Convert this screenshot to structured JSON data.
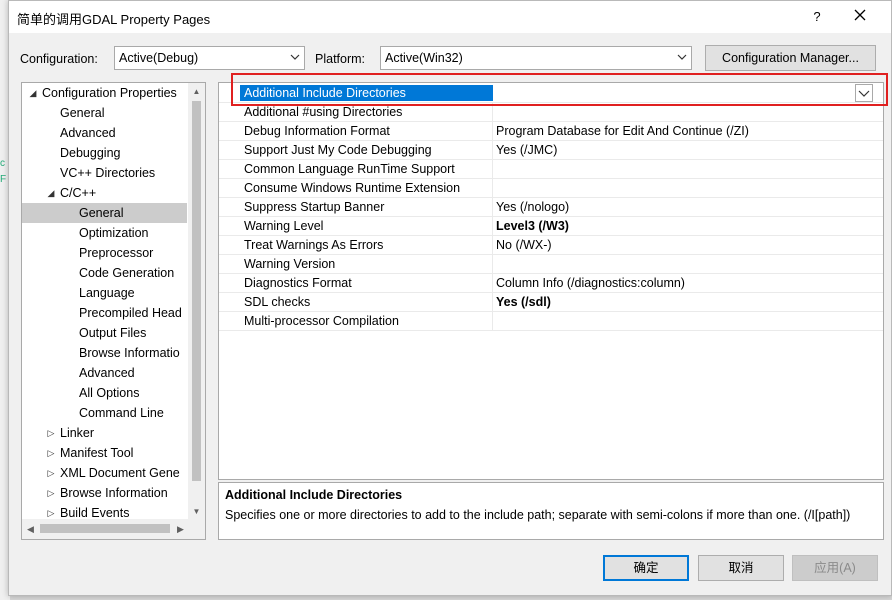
{
  "window": {
    "title": "简单的调用GDAL Property Pages",
    "help_glyph": "?",
    "close_glyph": "✕"
  },
  "background": {
    "left_text_1": "c",
    "left_text_2": "F"
  },
  "toolbar": {
    "configuration_label": "Configuration:",
    "configuration_value": "Active(Debug)",
    "platform_label": "Platform:",
    "platform_value": "Active(Win32)",
    "config_manager_label": "Configuration Manager..."
  },
  "tree": {
    "items": [
      {
        "label": "Configuration Properties",
        "glyph": "◢"
      },
      {
        "label": "General",
        "glyph": ""
      },
      {
        "label": "Advanced",
        "glyph": ""
      },
      {
        "label": "Debugging",
        "glyph": ""
      },
      {
        "label": "VC++ Directories",
        "glyph": ""
      },
      {
        "label": "C/C++",
        "glyph": "◢"
      },
      {
        "label": "General",
        "glyph": ""
      },
      {
        "label": "Optimization",
        "glyph": ""
      },
      {
        "label": "Preprocessor",
        "glyph": ""
      },
      {
        "label": "Code Generation",
        "glyph": ""
      },
      {
        "label": "Language",
        "glyph": ""
      },
      {
        "label": "Precompiled Head",
        "glyph": ""
      },
      {
        "label": "Output Files",
        "glyph": ""
      },
      {
        "label": "Browse Informatio",
        "glyph": ""
      },
      {
        "label": "Advanced",
        "glyph": ""
      },
      {
        "label": "All Options",
        "glyph": ""
      },
      {
        "label": "Command Line",
        "glyph": ""
      },
      {
        "label": "Linker",
        "glyph": "▷"
      },
      {
        "label": "Manifest Tool",
        "glyph": "▷"
      },
      {
        "label": "XML Document Gene",
        "glyph": "▷"
      },
      {
        "label": "Browse Information",
        "glyph": "▷"
      },
      {
        "label": "Build Events",
        "glyph": "▷"
      }
    ],
    "selected_index": 6
  },
  "grid": {
    "rows": [
      {
        "name": "Additional Include Directories",
        "value": "",
        "bold": false
      },
      {
        "name": "Additional #using Directories",
        "value": "",
        "bold": false
      },
      {
        "name": "Debug Information Format",
        "value": "Program Database for Edit And Continue (/ZI)",
        "bold": false
      },
      {
        "name": "Support Just My Code Debugging",
        "value": "Yes (/JMC)",
        "bold": false
      },
      {
        "name": "Common Language RunTime Support",
        "value": "",
        "bold": false
      },
      {
        "name": "Consume Windows Runtime Extension",
        "value": "",
        "bold": false
      },
      {
        "name": "Suppress Startup Banner",
        "value": "Yes (/nologo)",
        "bold": false
      },
      {
        "name": "Warning Level",
        "value": "Level3 (/W3)",
        "bold": true
      },
      {
        "name": "Treat Warnings As Errors",
        "value": "No (/WX-)",
        "bold": false
      },
      {
        "name": "Warning Version",
        "value": "",
        "bold": false
      },
      {
        "name": "Diagnostics Format",
        "value": "Column Info (/diagnostics:column)",
        "bold": false
      },
      {
        "name": "SDL checks",
        "value": "Yes (/sdl)",
        "bold": true
      },
      {
        "name": "Multi-processor Compilation",
        "value": "",
        "bold": false
      }
    ]
  },
  "description": {
    "title": "Additional Include Directories",
    "text": "Specifies one or more directories to add to the include path; separate with semi-colons if more than one. (/I[path])"
  },
  "buttons": {
    "ok": "确定",
    "cancel": "取消",
    "apply": "应用(A)"
  },
  "colors": {
    "selection": "#0078d7",
    "highlight_box": "#e02020",
    "tree_selected": "#cccccc"
  }
}
